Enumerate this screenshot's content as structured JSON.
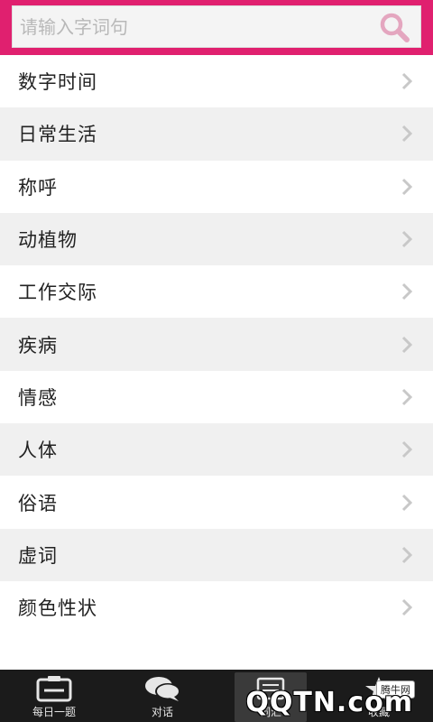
{
  "search": {
    "placeholder": "请输入字词句"
  },
  "categories": [
    {
      "label": "数字时间"
    },
    {
      "label": "日常生活"
    },
    {
      "label": "称呼"
    },
    {
      "label": "动植物"
    },
    {
      "label": "工作交际"
    },
    {
      "label": "疾病"
    },
    {
      "label": "情感"
    },
    {
      "label": "人体"
    },
    {
      "label": "俗语"
    },
    {
      "label": "虚词"
    },
    {
      "label": "颜色性状"
    }
  ],
  "tabs": [
    {
      "label": "每日一题",
      "icon": "calendar-icon"
    },
    {
      "label": "对话",
      "icon": "chat-bubbles-icon"
    },
    {
      "label": "词汇",
      "icon": "vocabulary-icon",
      "active": true
    },
    {
      "label": "收藏",
      "icon": "star-icon"
    }
  ],
  "watermark": {
    "text": "QQTN.com",
    "tag": "腾牛网"
  },
  "colors": {
    "accent": "#e0206f",
    "tab_bg": "#1b1b1b",
    "row_alt": "#f0f0f0",
    "search_icon": "#e4a6bf"
  }
}
